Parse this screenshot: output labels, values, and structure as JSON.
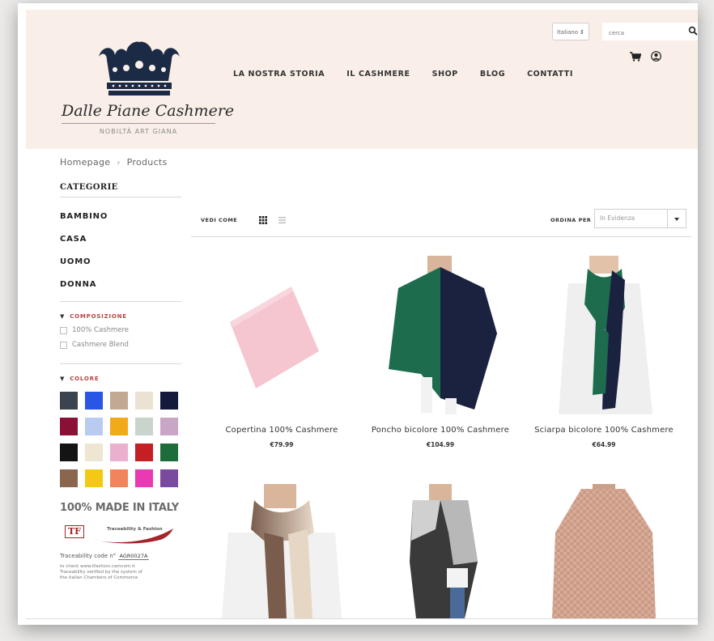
{
  "brand": {
    "script_name": "Dalle Piane Cashmere",
    "tagline": "NOBILTÀ ART GIANA",
    "crown_color": "#1c2b45"
  },
  "nav": {
    "items": [
      "LA NOSTRA STORIA",
      "IL CASHMERE",
      "SHOP",
      "BLOG",
      "CONTATTI"
    ]
  },
  "header": {
    "language": "Italiano",
    "search_placeholder": "cerca",
    "icons": [
      "search-icon",
      "cart-icon",
      "user-icon"
    ]
  },
  "breadcrumb": {
    "home": "Homepage",
    "current": "Products"
  },
  "sidebar": {
    "categories_title": "CATEGORIE",
    "categories": [
      "BAMBINO",
      "CASA",
      "UOMO",
      "DONNA"
    ],
    "composition_title": "COMPOSIZIONE",
    "composition_options": [
      "100% Cashmere",
      "Cashmere Blend"
    ],
    "color_title": "COLORE",
    "colors": [
      "#3b4350",
      "#2a56e6",
      "#c2a993",
      "#ece2d4",
      "#131a3b",
      "#8a1036",
      "#b9cbf0",
      "#f2aa1b",
      "#c9d4cc",
      "#c9a6c6",
      "#141414",
      "#eee5d2",
      "#eab0cd",
      "#c31f25",
      "#1d6c3a",
      "#8b664f",
      "#f3c915",
      "#f0845a",
      "#e93ab4",
      "#7a4aa0"
    ]
  },
  "trace": {
    "made_in_italy": "100% MADE IN ITALY",
    "tf_label": "TF",
    "tf_text": "Traceability & Fashion",
    "code_label": "Traceability code n°",
    "code_value": "AGR0027A",
    "note_1": "to check www.tfashion.camcom.it",
    "note_2": "Traceability verified by the system of",
    "note_3": "the italian Chambers of Commerce"
  },
  "toolbar": {
    "view_label": "VEDI COME",
    "sort_label": "ORDINA PER",
    "sort_value": "In Evidenza"
  },
  "products": [
    {
      "name": "Copertina 100% Cashmere",
      "price": "€79.99"
    },
    {
      "name": "Poncho bicolore 100% Cashmere",
      "price": "€104.99"
    },
    {
      "name": "Sciarpa bicolore 100% Cashmere",
      "price": "€64.99"
    },
    {
      "name": "",
      "price": ""
    },
    {
      "name": "",
      "price": ""
    },
    {
      "name": "",
      "price": ""
    }
  ]
}
